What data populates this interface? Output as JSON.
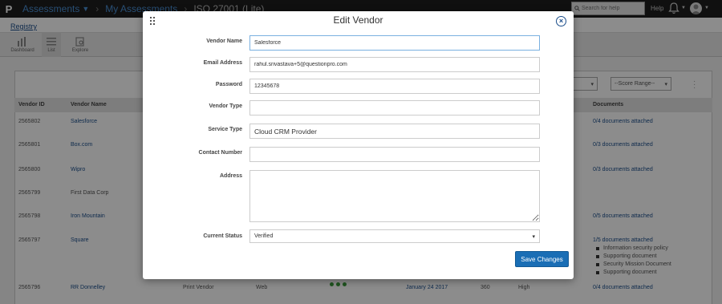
{
  "topbar": {
    "logo": "P",
    "crumbs": [
      "Assessments",
      "My Assessments",
      "ISO 27001 (Lite)"
    ],
    "search_placeholder": "Search for help",
    "help": "Help"
  },
  "subbar": {
    "registry": "Registry"
  },
  "viewbar": {
    "items": [
      "Dashboard",
      "List",
      "Explore"
    ]
  },
  "filters": {
    "score_range": "--Score Range--"
  },
  "table": {
    "headers": {
      "vendor_id": "Vendor ID",
      "vendor_name": "Vendor Name",
      "documents": "Documents"
    },
    "rows": [
      {
        "id": "2565802",
        "name": "Salesforce",
        "docs": "0/4 documents attached"
      },
      {
        "id": "2565801",
        "name": "Box.com",
        "docs": "0/3 documents attached"
      },
      {
        "id": "2565800",
        "name": "Wipro",
        "docs": "0/3 documents attached"
      },
      {
        "id": "2565799",
        "name": "First Data Corp",
        "docs": ""
      },
      {
        "id": "2565798",
        "name": "Iron Mountain",
        "docs": "0/5 documents attached"
      },
      {
        "id": "2565797",
        "name": "Square",
        "docs": "1/5 documents attached",
        "doc_list": [
          "Information security policy",
          "Supporting document",
          "Security Mission Document",
          "Supporting document"
        ]
      },
      {
        "id": "2565796",
        "name": "RR Donnelley",
        "docs": "0/4 documents attached",
        "service": "Print Vendor",
        "type": "Web",
        "date": "January 24 2017",
        "score": "360",
        "risk": "High"
      }
    ]
  },
  "modal": {
    "title": "Edit Vendor",
    "fields": {
      "vendor_name": {
        "label": "Vendor Name",
        "value": "Salesforce"
      },
      "email": {
        "label": "Email Address",
        "value": "rahul.srivastava+5@questionpro.com"
      },
      "password": {
        "label": "Password",
        "value": "12345678"
      },
      "vendor_type": {
        "label": "Vendor Type",
        "value": ""
      },
      "service_type": {
        "label": "Service Type",
        "value": "Cloud CRM Provider"
      },
      "contact": {
        "label": "Contact Number",
        "value": ""
      },
      "address": {
        "label": "Address",
        "value": ""
      },
      "status": {
        "label": "Current Status",
        "value": "Verified"
      }
    },
    "save_label": "Save Changes"
  },
  "colors": {
    "accent": "#1a6eb5",
    "link": "#1a4d8a",
    "topbar": "#1e1e1e",
    "status_dot": "#3a9a3a"
  }
}
